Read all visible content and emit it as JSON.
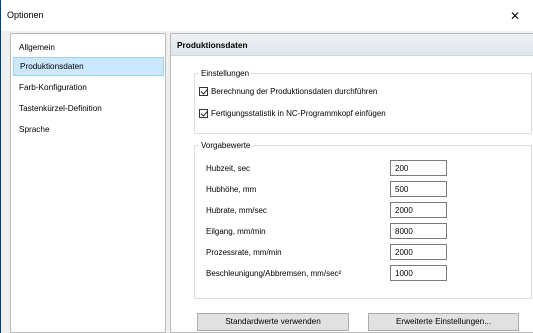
{
  "window": {
    "title": "Optionen",
    "close_symbol": "✕"
  },
  "sidebar": {
    "items": [
      {
        "label": "Allgemein"
      },
      {
        "label": "Produktionsdaten",
        "selected": true
      },
      {
        "label": "Farb-Konfiguration"
      },
      {
        "label": "Tastenkürzel-Definition"
      },
      {
        "label": "Sprache"
      }
    ]
  },
  "panel": {
    "header": "Produktionsdaten",
    "settings_group": {
      "legend": "Einstellungen",
      "checkboxes": [
        {
          "label": "Berechnung der Produktionsdaten durchführen",
          "checked": true
        },
        {
          "label": "Fertigungsstatistik in NC-Programmkopf einfügen",
          "checked": true
        }
      ]
    },
    "defaults_group": {
      "legend": "Vorgabewerte",
      "fields": [
        {
          "label": "Hubzeit, sec",
          "value": "200"
        },
        {
          "label": "Hubhöhe, mm",
          "value": "500"
        },
        {
          "label": "Hubrate, mm/sec",
          "value": "2000"
        },
        {
          "label": "Eilgang, mm/min",
          "value": "8000"
        },
        {
          "label": "Prozessrate, mm/min",
          "value": "2000"
        },
        {
          "label": "Beschleunigung/Abbremsen, mm/sec²",
          "value": "1000"
        }
      ]
    },
    "buttons": {
      "defaults_label": "Standardwerte verwenden",
      "advanced_label": "Erweiterte Einstellungen..."
    }
  }
}
